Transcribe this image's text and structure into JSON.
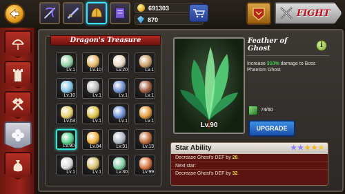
{
  "header": {
    "currency": [
      {
        "icon": "gold-coin-icon",
        "value": "691303"
      },
      {
        "icon": "gem-icon",
        "value": "870"
      }
    ],
    "fight_label": "FIGHT"
  },
  "treasure": {
    "title": "Dragon's Treasure",
    "slots": [
      {
        "lv": "Lv.1",
        "color": "#8fd0a5",
        "selected": false
      },
      {
        "lv": "Lv.10",
        "color": "#e6b86a",
        "selected": false
      },
      {
        "lv": "Lv.20",
        "color": "#e8d8c0",
        "selected": false
      },
      {
        "lv": "Lv.1",
        "color": "#c9a06a",
        "selected": false
      },
      {
        "lv": "Lv.10",
        "color": "#7fc3e4",
        "selected": false
      },
      {
        "lv": "Lv.1",
        "color": "#b8b8b8",
        "selected": false
      },
      {
        "lv": "Lv.1",
        "color": "#6f8fc9",
        "selected": false
      },
      {
        "lv": "Lv.1",
        "color": "#a05b3e",
        "selected": false
      },
      {
        "lv": "Lv.63",
        "color": "#e4d26b",
        "selected": false
      },
      {
        "lv": "Lv.1",
        "color": "#e0c34a",
        "selected": false
      },
      {
        "lv": "Lv.1",
        "color": "#6f8fd5",
        "selected": false
      },
      {
        "lv": "Lv.1",
        "color": "#e09a3a",
        "selected": false
      },
      {
        "lv": "Lv.90",
        "color": "#4fcf8b",
        "selected": true
      },
      {
        "lv": "Lv.84",
        "color": "#f0b040",
        "selected": false
      },
      {
        "lv": "Lv.91",
        "color": "#b0bac8",
        "selected": false
      },
      {
        "lv": "Lv.13",
        "color": "#c06a3a",
        "selected": false
      },
      {
        "lv": "Lv.1",
        "color": "#d9d9d9",
        "selected": false
      },
      {
        "lv": "Lv.1",
        "color": "#d8c070",
        "selected": false
      },
      {
        "lv": "Lv.30",
        "color": "#7fcfa0",
        "selected": false
      },
      {
        "lv": "Lv.99",
        "color": "#d8743a",
        "selected": false
      }
    ]
  },
  "item": {
    "name": "Feather of Ghost",
    "level": "Lv.90",
    "desc_prefix": "Increase ",
    "desc_highlight": "310%",
    "desc_suffix": " damage to Boss Phantom Ghost",
    "shards": "74/60",
    "upgrade_label": "UPGRADE"
  },
  "star_ability": {
    "title": "Star Ability",
    "stars_filled": 4,
    "stars_total": 5,
    "current_prefix": "Decrease Ghost's DEF by ",
    "current_value": "28",
    "current_suffix": ".",
    "next_label": "Next star:",
    "next_prefix": "Decrease Ghost's DEF by ",
    "next_value": "32",
    "next_suffix": "."
  }
}
